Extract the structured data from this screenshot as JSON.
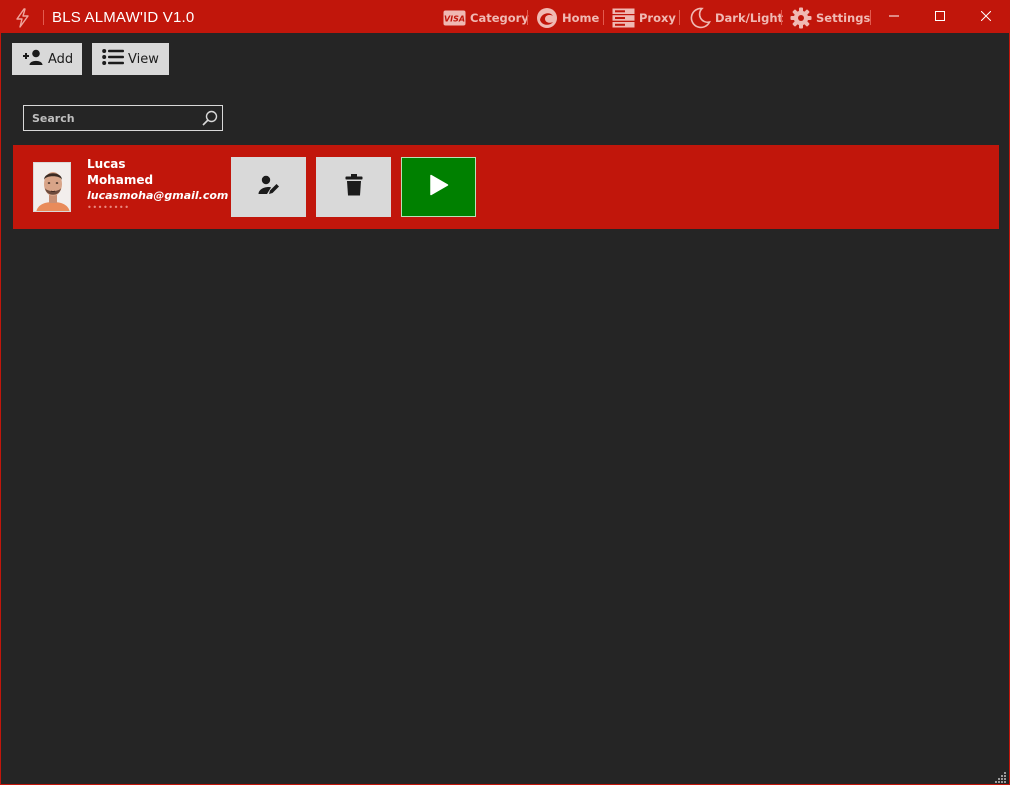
{
  "window": {
    "title": "BLS ALMAW'ID V1.0",
    "accent_color": "#c1160b",
    "background_color": "#252525"
  },
  "nav": [
    {
      "label": "Category",
      "icon": "visa-card-icon"
    },
    {
      "label": "Home",
      "icon": "home-swirl-icon"
    },
    {
      "label": "Proxy",
      "icon": "server-icon"
    },
    {
      "label": "Dark/Light",
      "icon": "moon-icon"
    },
    {
      "label": "Settings",
      "icon": "gear-icon"
    }
  ],
  "visa_badge": "VISA",
  "window_controls": [
    "minimize",
    "maximize",
    "close"
  ],
  "toolbar": {
    "add_label": "Add",
    "view_label": "View"
  },
  "search": {
    "placeholder": "Search",
    "value": ""
  },
  "users": [
    {
      "first_name": "Lucas",
      "last_name": "Mohamed",
      "email": "lucasmoha@gmail.com",
      "password_mask": "••••••••",
      "actions": [
        "edit",
        "delete",
        "start"
      ],
      "start_color": "#008000"
    }
  ]
}
